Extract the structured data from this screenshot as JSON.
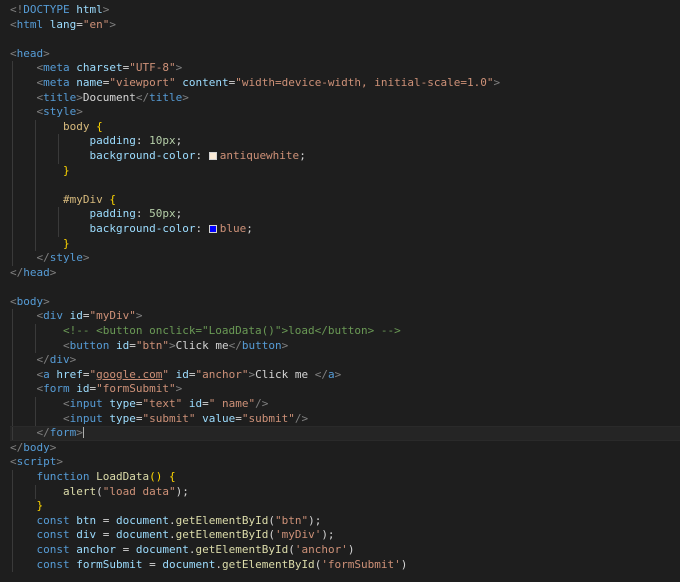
{
  "colors": {
    "antiquewhite": "#faebd7",
    "blue": "#0000ff"
  },
  "code": {
    "l1_open": "<!",
    "l1_doctype": "DOCTYPE",
    "l1_html": " html",
    "l1_close": ">",
    "l2_tag": "html",
    "l2_attr": "lang",
    "l2_val": "\"en\"",
    "l4_tag": "head",
    "l5_tag": "meta",
    "l5_attr": "charset",
    "l5_val": "\"UTF-8\"",
    "l6_tag": "meta",
    "l6_attr1": "name",
    "l6_val1": "\"viewport\"",
    "l6_attr2": "content",
    "l6_val2": "\"width=device-width, initial-scale=1.0\"",
    "l7_tag": "title",
    "l7_text": "Document",
    "l8_tag": "style",
    "l9_sel": "body",
    "l9_brace": "{",
    "l10_prop": "padding",
    "l10_num": "10px",
    "l11_prop": "background-color",
    "l11_val": "antiquewhite",
    "l12_brace": "}",
    "l14_sel": "#myDiv",
    "l14_brace": "{",
    "l15_prop": "padding",
    "l15_num": "50px",
    "l16_prop": "background-color",
    "l16_val": "blue",
    "l17_brace": "}",
    "l18_tag": "style",
    "l19_tag": "head",
    "l21_tag": "body",
    "l22_tag": "div",
    "l22_attr": "id",
    "l22_val": "\"myDiv\"",
    "l23_comment": "<!-- <button onclick=\"LoadData()\">load</button> -->",
    "l24_tag": "button",
    "l24_attr": "id",
    "l24_val": "\"btn\"",
    "l24_text": "Click me",
    "l25_tag": "div",
    "l26_tag": "a",
    "l26_attr1": "href",
    "l26_quote_open": "\"",
    "l26_link": "google.com",
    "l26_quote_close": "\"",
    "l26_attr2": "id",
    "l26_val2": "\"anchor\"",
    "l26_text": "Click me ",
    "l27_tag": "form",
    "l27_attr": "id",
    "l27_val": "\"formSubmit\"",
    "l28_tag": "input",
    "l28_attr1": "type",
    "l28_val1": "\"text\"",
    "l28_attr2": "id",
    "l28_val2": "\" name\"",
    "l29_tag": "input",
    "l29_attr1": "type",
    "l29_val1": "\"submit\"",
    "l29_attr2": "value",
    "l29_val2": "\"submit\"",
    "l30_tag": "form",
    "l31_tag": "body",
    "l32_tag": "script",
    "l33_kw": "function",
    "l33_fn": "LoadData",
    "l33_rest": "() {",
    "l34_fn": "alert",
    "l34_str": "\"load data\"",
    "l35_brace": "}",
    "l36_kw": "const",
    "l36_var": "btn",
    "l36_obj": "document",
    "l36_fn": "getElementById",
    "l36_str": "\"btn\"",
    "l37_kw": "const",
    "l37_var": "div",
    "l37_obj": "document",
    "l37_fn": "getElementById",
    "l37_str": "'myDiv'",
    "l38_kw": "const",
    "l38_var": "anchor",
    "l38_obj": "document",
    "l38_fn": "getElementById",
    "l38_str": "'anchor'",
    "l39_kw": "const",
    "l39_var": "formSubmit",
    "l39_obj": "document",
    "l39_fn": "getElementById",
    "l39_str": "'formSubmit'"
  }
}
